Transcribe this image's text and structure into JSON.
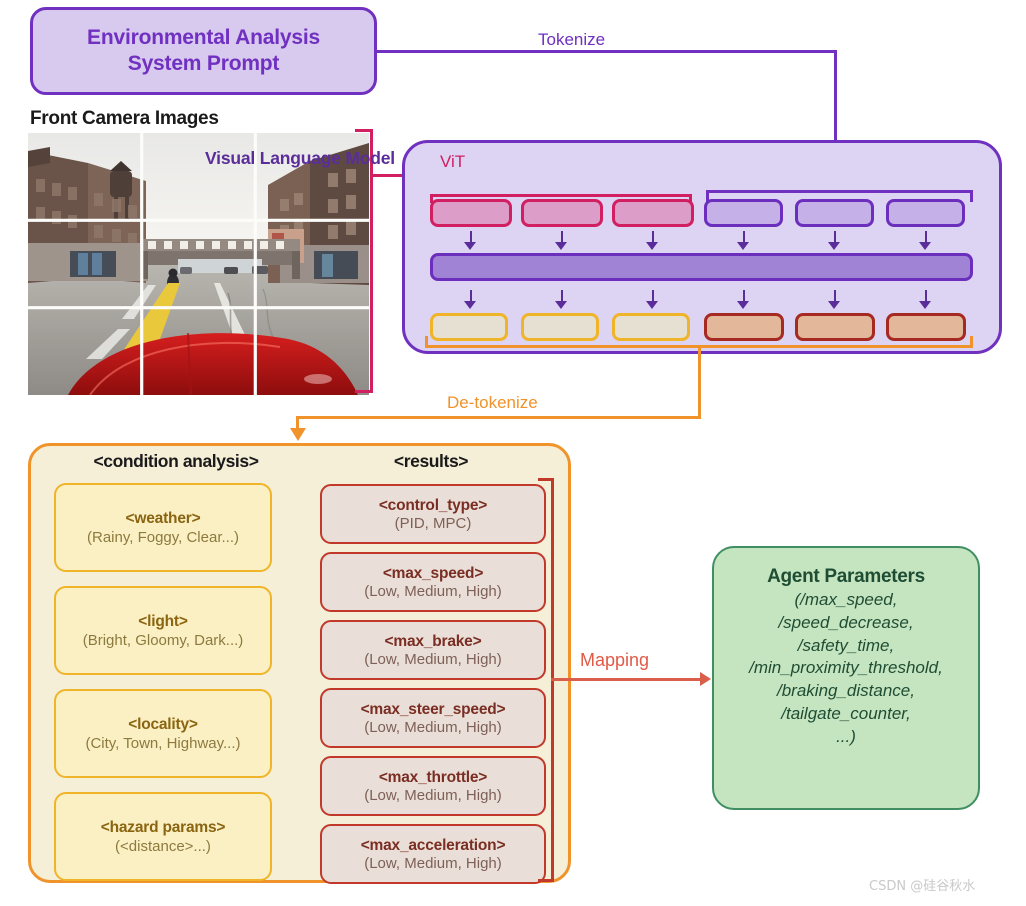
{
  "system_prompt": {
    "title_line1": "Environmental Analysis",
    "title_line2": "System Prompt"
  },
  "camera": {
    "title": "Front Camera Images"
  },
  "vlm": {
    "title": "Visual Language Model",
    "vit_label": "ViT",
    "image_tokens": [
      "",
      "",
      ""
    ],
    "text_tokens": [
      "",
      "",
      ""
    ],
    "transformer_label": "",
    "output_tokens_left": [
      "",
      "",
      ""
    ],
    "output_tokens_right": [
      "",
      "",
      ""
    ]
  },
  "edges": {
    "tokenize": "Tokenize",
    "detokenize": "De-tokenize",
    "mapping": "Mapping"
  },
  "condition_analysis": {
    "header": "<condition analysis>",
    "items": [
      {
        "tag": "<weather>",
        "values": "(Rainy, Foggy, Clear...)"
      },
      {
        "tag": "<light>",
        "values": "(Bright, Gloomy, Dark...)"
      },
      {
        "tag": "<locality>",
        "values": "(City, Town, Highway...)"
      },
      {
        "tag": "<hazard params>",
        "values": "(<distance>...)"
      }
    ]
  },
  "results": {
    "header": "<results>",
    "items": [
      {
        "tag": "<control_type>",
        "values": "(PID, MPC)"
      },
      {
        "tag": "<max_speed>",
        "values": "(Low, Medium, High)"
      },
      {
        "tag": "<max_brake>",
        "values": "(Low, Medium, High)"
      },
      {
        "tag": "<max_steer_speed>",
        "values": "(Low, Medium, High)"
      },
      {
        "tag": "<max_throttle>",
        "values": "(Low, Medium, High)"
      },
      {
        "tag": "<max_acceleration>",
        "values": "(Low, Medium, High)"
      }
    ]
  },
  "agent_parameters": {
    "title": "Agent Parameters",
    "list": "(/max_speed,\n/speed_decrease,\n/safety_time,\n/min_proximity_threshold,\n/braking_distance,\n/tailgate_counter,\n...)"
  },
  "watermark": {
    "text": "CSDN @硅谷秋水"
  },
  "colors": {
    "purple": "#7030c0",
    "purple_fill": "#d8c9ee",
    "vlm_fill": "#ddd3f2",
    "crimson": "#d21f61",
    "orange": "#f0932b",
    "cream": "#f5efd8",
    "yellow": "#f0b429",
    "red": "#c0392b",
    "green": "#3f8f63",
    "green_fill": "#c5e4c0",
    "mapping_red": "#e05a47"
  }
}
